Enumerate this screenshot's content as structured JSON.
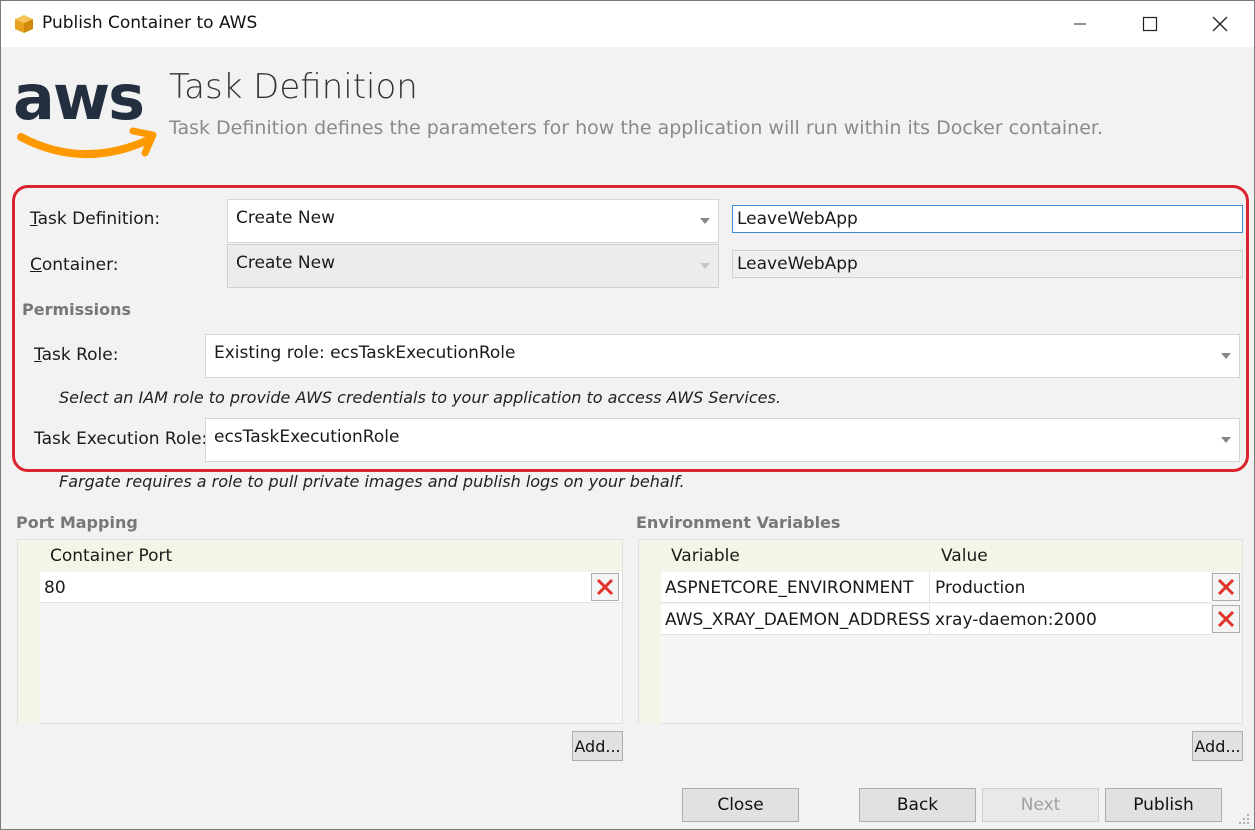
{
  "window": {
    "title": "Publish Container to AWS",
    "icon": "aws-box-icon",
    "controls": [
      "minimize-icon",
      "maximize-icon",
      "close-icon"
    ]
  },
  "header": {
    "title": "Task Definition",
    "subtitle": "Task Definition defines the parameters for how the application will run within its Docker container."
  },
  "form": {
    "task_definition": {
      "label_accel": "T",
      "label_rest": "ask Definition:",
      "selected": "Create New",
      "name": "LeaveWebApp"
    },
    "container": {
      "label_accel": "C",
      "label_rest": "ontainer:",
      "selected": "Create New",
      "name": "LeaveWebApp"
    },
    "permissions": {
      "section_title": "Permissions",
      "task_role_accel": "T",
      "task_role_rest": "ask Role:",
      "task_role_value": "Existing role: ecsTaskExecutionRole",
      "task_role_hint": "Select an IAM role to provide AWS credentials to your application to access AWS Services.",
      "exec_role_label": "Task Execution Role:",
      "exec_role_value": "ecsTaskExecutionRole",
      "exec_role_hint": "Fargate requires a role to pull private images and publish logs on your behalf."
    }
  },
  "port_mapping": {
    "section_title": "Port Mapping",
    "columns": [
      "Container Port"
    ],
    "rows": [
      [
        "80"
      ]
    ],
    "add_label": "Add..."
  },
  "env_vars": {
    "section_title": "Environment Variables",
    "columns": [
      "Variable",
      "Value"
    ],
    "rows": [
      [
        "ASPNETCORE_ENVIRONMENT",
        "Production"
      ],
      [
        "AWS_XRAY_DAEMON_ADDRESS",
        "xray-daemon:2000"
      ]
    ],
    "add_label": "Add..."
  },
  "footer": {
    "close": "Close",
    "back": "Back",
    "next": "Next",
    "publish": "Publish"
  },
  "colors": {
    "highlight": "#d9232e",
    "aws_orange": "#ff9900",
    "aws_dark": "#232f3e",
    "delete_red": "#e0312b"
  }
}
